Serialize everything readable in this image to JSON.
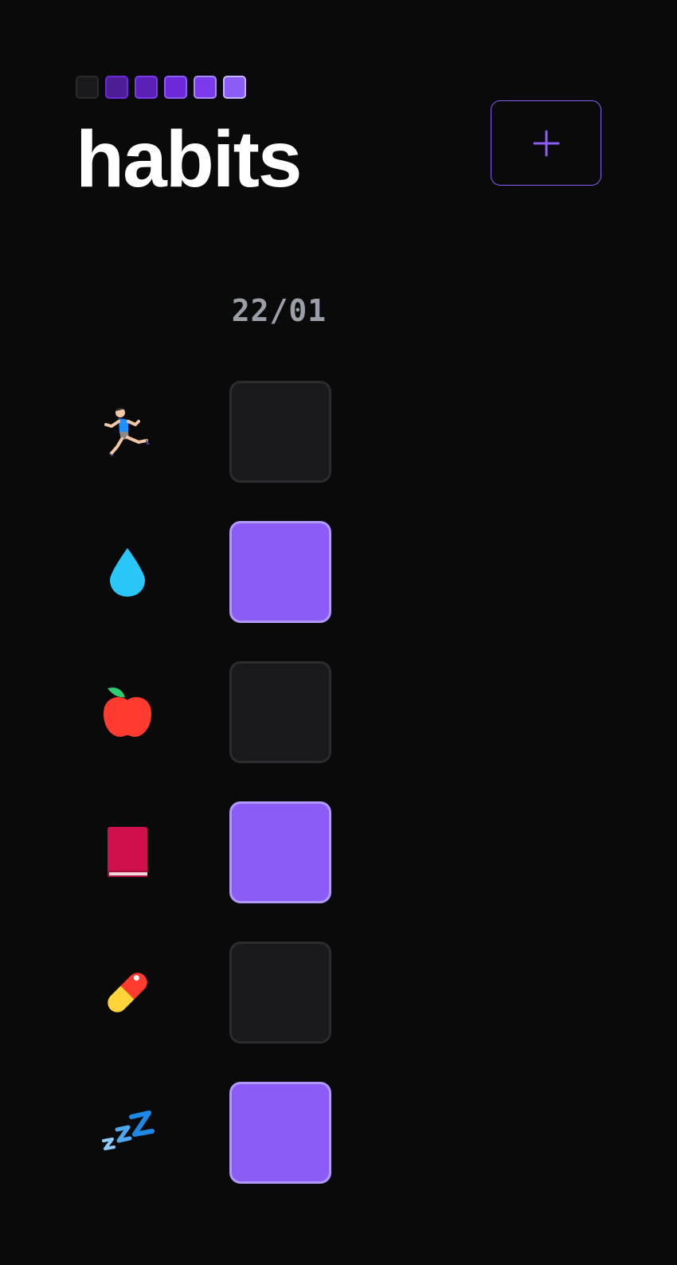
{
  "app": {
    "title": "habits",
    "add_button_icon": "plus-icon",
    "accent_color": "#8b5cf6"
  },
  "logo": {
    "squares": [
      {
        "fill": "#1a1a1c",
        "border": "#2a2a2c"
      },
      {
        "fill": "#4c1d95",
        "border": "#6d28d9"
      },
      {
        "fill": "#5b21b6",
        "border": "#7c3aed"
      },
      {
        "fill": "#6d28d9",
        "border": "#8b5cf6"
      },
      {
        "fill": "#7c3aed",
        "border": "#a78bfa"
      },
      {
        "fill": "#8b5cf6",
        "border": "#c4b5fd"
      }
    ]
  },
  "date_column": {
    "label": "22/01"
  },
  "habits": [
    {
      "icon": "runner-icon",
      "done": false
    },
    {
      "icon": "water-drop-icon",
      "done": true
    },
    {
      "icon": "apple-icon",
      "done": false
    },
    {
      "icon": "book-icon",
      "done": true
    },
    {
      "icon": "pill-icon",
      "done": false
    },
    {
      "icon": "sleep-zzz-icon",
      "done": true
    }
  ]
}
